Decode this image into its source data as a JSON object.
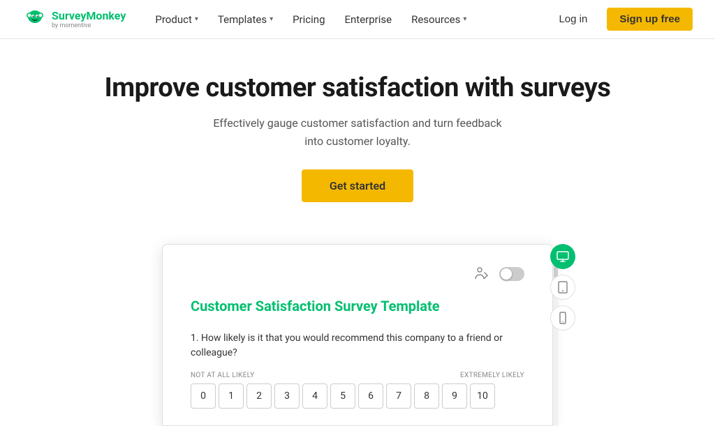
{
  "brand": {
    "name": "SurveyMonkey",
    "tagline": "by momentive"
  },
  "nav": {
    "items": [
      {
        "label": "Product",
        "hasDropdown": true
      },
      {
        "label": "Templates",
        "hasDropdown": true
      },
      {
        "label": "Pricing",
        "hasDropdown": false
      },
      {
        "label": "Enterprise",
        "hasDropdown": false
      },
      {
        "label": "Resources",
        "hasDropdown": true
      }
    ],
    "login_label": "Log in",
    "signup_label": "Sign up free"
  },
  "hero": {
    "title": "Improve customer satisfaction with surveys",
    "subtitle": "Effectively gauge customer satisfaction and turn feedback into customer loyalty.",
    "cta_label": "Get started"
  },
  "survey_preview": {
    "title": "Customer Satisfaction Survey Template",
    "question": "1. How likely is it that you would recommend this company to a friend or colleague?",
    "scale_label_left": "NOT AT ALL LIKELY",
    "scale_label_right": "EXTREMELY LIKELY",
    "scale_numbers": [
      "0",
      "1",
      "2",
      "3",
      "4",
      "5",
      "6",
      "7",
      "8",
      "9",
      "10"
    ]
  },
  "sidebar_icons": {
    "desktop_label": "desktop view",
    "tablet_label": "tablet view",
    "mobile_label": "mobile view"
  }
}
